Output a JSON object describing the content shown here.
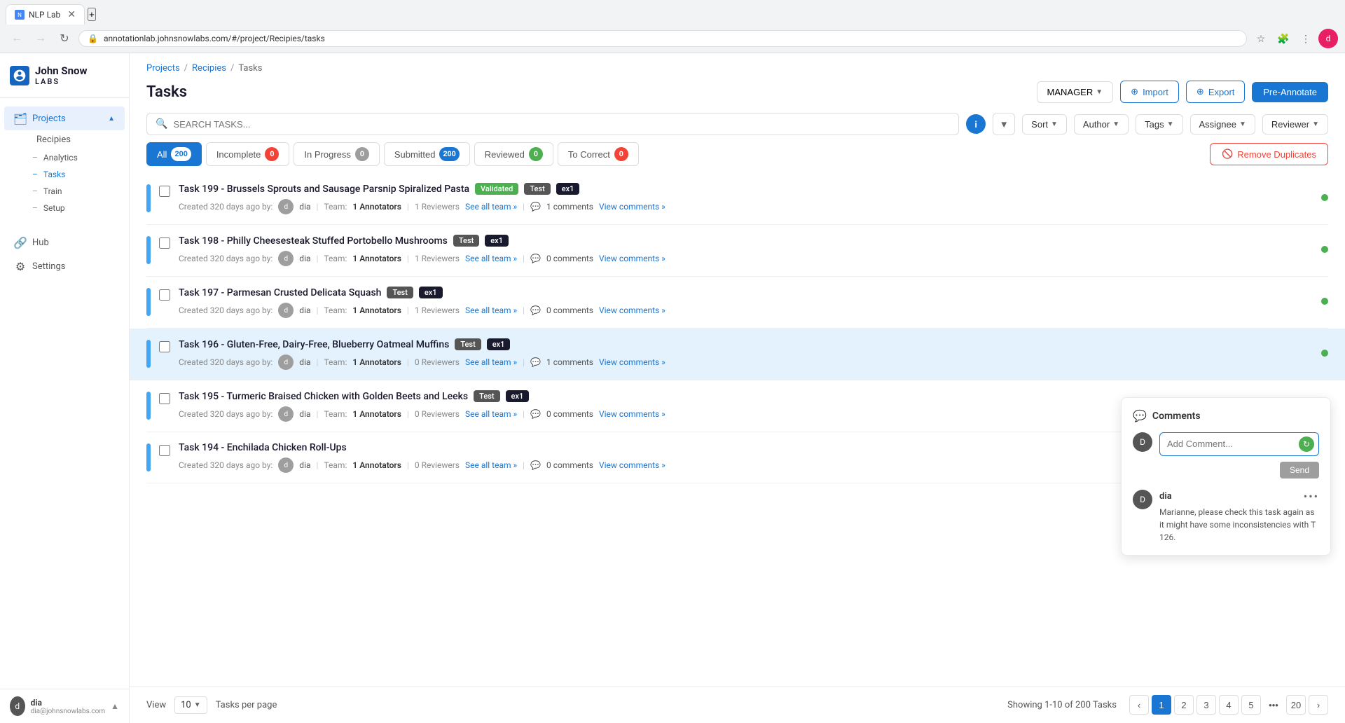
{
  "browser": {
    "tab_label": "NLP Lab",
    "address": "annotationlab.johnsnowlabs.com/#/project/Recipies/tasks"
  },
  "sidebar": {
    "brand1": "John Snow",
    "brand2": "LABS",
    "nav_items": [
      {
        "id": "projects",
        "label": "Projects",
        "icon": "🗂",
        "active": true,
        "expanded": true
      },
      {
        "id": "hub",
        "label": "Hub",
        "icon": "🔗",
        "active": false
      },
      {
        "id": "settings",
        "label": "Settings",
        "icon": "⚙",
        "active": false
      }
    ],
    "sub_items": [
      {
        "id": "recipies",
        "label": "Recipies",
        "active": false
      },
      {
        "id": "analytics",
        "label": "Analytics",
        "active": false
      },
      {
        "id": "tasks",
        "label": "Tasks",
        "active": true
      },
      {
        "id": "train",
        "label": "Train",
        "active": false
      },
      {
        "id": "setup",
        "label": "Setup",
        "active": false
      }
    ],
    "user": {
      "initial": "d",
      "name": "dia",
      "email": "dia@johnsnowlabs.com"
    }
  },
  "breadcrumb": {
    "projects_label": "Projects",
    "recipies_label": "Recipies",
    "tasks_label": "Tasks"
  },
  "header": {
    "title": "Tasks",
    "manager_btn": "MANAGER",
    "import_btn": "Import",
    "export_btn": "Export",
    "preannotate_btn": "Pre-Annotate"
  },
  "toolbar": {
    "search_placeholder": "SEARCH TASKS...",
    "sort_label": "Sort",
    "author_label": "Author",
    "tags_label": "Tags",
    "assignee_label": "Assignee",
    "reviewer_label": "Reviewer"
  },
  "tabs": [
    {
      "id": "all",
      "label": "All",
      "count": "200",
      "badge_type": "active-badge",
      "active": true
    },
    {
      "id": "incomplete",
      "label": "Incomplete",
      "count": "0",
      "badge_type": "red",
      "active": false
    },
    {
      "id": "in_progress",
      "label": "In Progress",
      "count": "0",
      "badge_type": "grey",
      "active": false
    },
    {
      "id": "submitted",
      "label": "Submitted",
      "count": "200",
      "badge_type": "blue",
      "active": false
    },
    {
      "id": "reviewed",
      "label": "Reviewed",
      "count": "0",
      "badge_type": "green",
      "active": false
    },
    {
      "id": "to_correct",
      "label": "To Correct",
      "count": "0",
      "badge_type": "red",
      "active": false
    }
  ],
  "remove_duplicates_btn": "Remove Duplicates",
  "tasks": [
    {
      "id": 199,
      "title": "Task 199 - Brussels Sprouts and Sausage Parsnip Spiralized Pasta",
      "tags": [
        "Validated",
        "Test",
        "ex1"
      ],
      "created": "Created 320 days ago by:",
      "author_initial": "d",
      "author_name": "dia",
      "annotators_count": "1 Annotators",
      "reviewers_count": "1 Reviewers",
      "see_all": "See all team »",
      "comments_count": "1 comments",
      "view_comments": "View comments »",
      "status": "green",
      "highlighted": false
    },
    {
      "id": 198,
      "title": "Task 198 - Philly Cheesesteak Stuffed Portobello Mushrooms",
      "tags": [
        "Test",
        "ex1"
      ],
      "created": "Created 320 days ago by:",
      "author_initial": "d",
      "author_name": "dia",
      "annotators_count": "1 Annotators",
      "reviewers_count": "1 Reviewers",
      "see_all": "See all team »",
      "comments_count": "0 comments",
      "view_comments": "View comments »",
      "status": "green",
      "highlighted": false
    },
    {
      "id": 197,
      "title": "Task 197 - Parmesan Crusted Delicata Squash",
      "tags": [
        "Test",
        "ex1"
      ],
      "created": "Created 320 days ago by:",
      "author_initial": "d",
      "author_name": "dia",
      "annotators_count": "1 Annotators",
      "reviewers_count": "1 Reviewers",
      "see_all": "See all team »",
      "comments_count": "0 comments",
      "view_comments": "View comments »",
      "status": "green",
      "highlighted": false
    },
    {
      "id": 196,
      "title": "Task 196 - Gluten-Free, Dairy-Free, Blueberry Oatmeal Muffins",
      "tags": [
        "Test",
        "ex1"
      ],
      "created": "Created 320 days ago by:",
      "author_initial": "d",
      "author_name": "dia",
      "annotators_count": "1 Annotators",
      "reviewers_count": "0 Reviewers",
      "see_all": "See all team »",
      "comments_count": "1 comments",
      "view_comments": "View comments »",
      "status": "green",
      "highlighted": true
    },
    {
      "id": 195,
      "title": "Task 195 - Turmeric Braised Chicken with Golden Beets and Leeks",
      "tags": [
        "Test",
        "ex1"
      ],
      "created": "Created 320 days ago by:",
      "author_initial": "d",
      "author_name": "dia",
      "annotators_count": "1 Annotators",
      "reviewers_count": "0 Reviewers",
      "see_all": "See all team »",
      "comments_count": "0 comments",
      "view_comments": "View comments »",
      "status": "green",
      "highlighted": false
    },
    {
      "id": 194,
      "title": "Task 194 - Enchilada Chicken Roll-Ups",
      "tags": [],
      "created": "Created 320 days ago by:",
      "author_initial": "d",
      "author_name": "dia",
      "annotators_count": "1 Annotators",
      "reviewers_count": "0 Reviewers",
      "see_all": "See all team »",
      "comments_count": "0 comments",
      "view_comments": "View comments »",
      "status": "green",
      "highlighted": false
    }
  ],
  "comments_panel": {
    "title": "Comments",
    "input_placeholder": "Add Comment...",
    "send_btn": "Send",
    "commenter_initial": "D",
    "comment_author": "dia",
    "comment_text": "Marianne, please check this task again as it might have some inconsistencies with T 126."
  },
  "pagination": {
    "view_label": "View",
    "per_page": "10",
    "per_page_label": "Tasks per page",
    "info": "Showing 1-10 of 200 Tasks",
    "current_page": 1,
    "pages": [
      "1",
      "2",
      "3",
      "4",
      "5",
      "...",
      "20"
    ]
  }
}
